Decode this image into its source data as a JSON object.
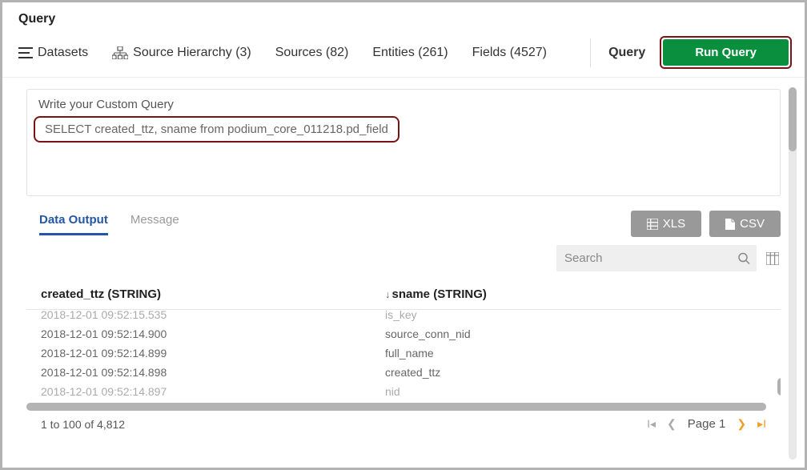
{
  "header": {
    "title": "Query"
  },
  "toolbar": {
    "datasets": "Datasets",
    "hierarchy": "Source Hierarchy (3)",
    "sources": "Sources (82)",
    "entities": "Entities (261)",
    "fields": "Fields (4527)",
    "query_label": "Query",
    "run": "Run Query"
  },
  "query": {
    "label": "Write your Custom Query",
    "text": "SELECT created_ttz, sname from podium_core_011218.pd_field"
  },
  "tabs": {
    "data_output": "Data Output",
    "message": "Message"
  },
  "export": {
    "xls": "XLS",
    "csv": "CSV"
  },
  "search": {
    "placeholder": "Search"
  },
  "columns": {
    "col1": "created_ttz (STRING)",
    "col2": "sname (STRING)"
  },
  "rows": [
    {
      "c1": "2018-12-01 09:52:15.535",
      "c2": "is_key"
    },
    {
      "c1": "2018-12-01 09:52:14.900",
      "c2": "source_conn_nid"
    },
    {
      "c1": "2018-12-01 09:52:14.899",
      "c2": "full_name"
    },
    {
      "c1": "2018-12-01 09:52:14.898",
      "c2": "created_ttz"
    },
    {
      "c1": "2018-12-01 09:52:14.897",
      "c2": "nid"
    }
  ],
  "footer": {
    "range": "1 to 100 of 4,812",
    "page_label": "Page",
    "page_num": "1"
  }
}
